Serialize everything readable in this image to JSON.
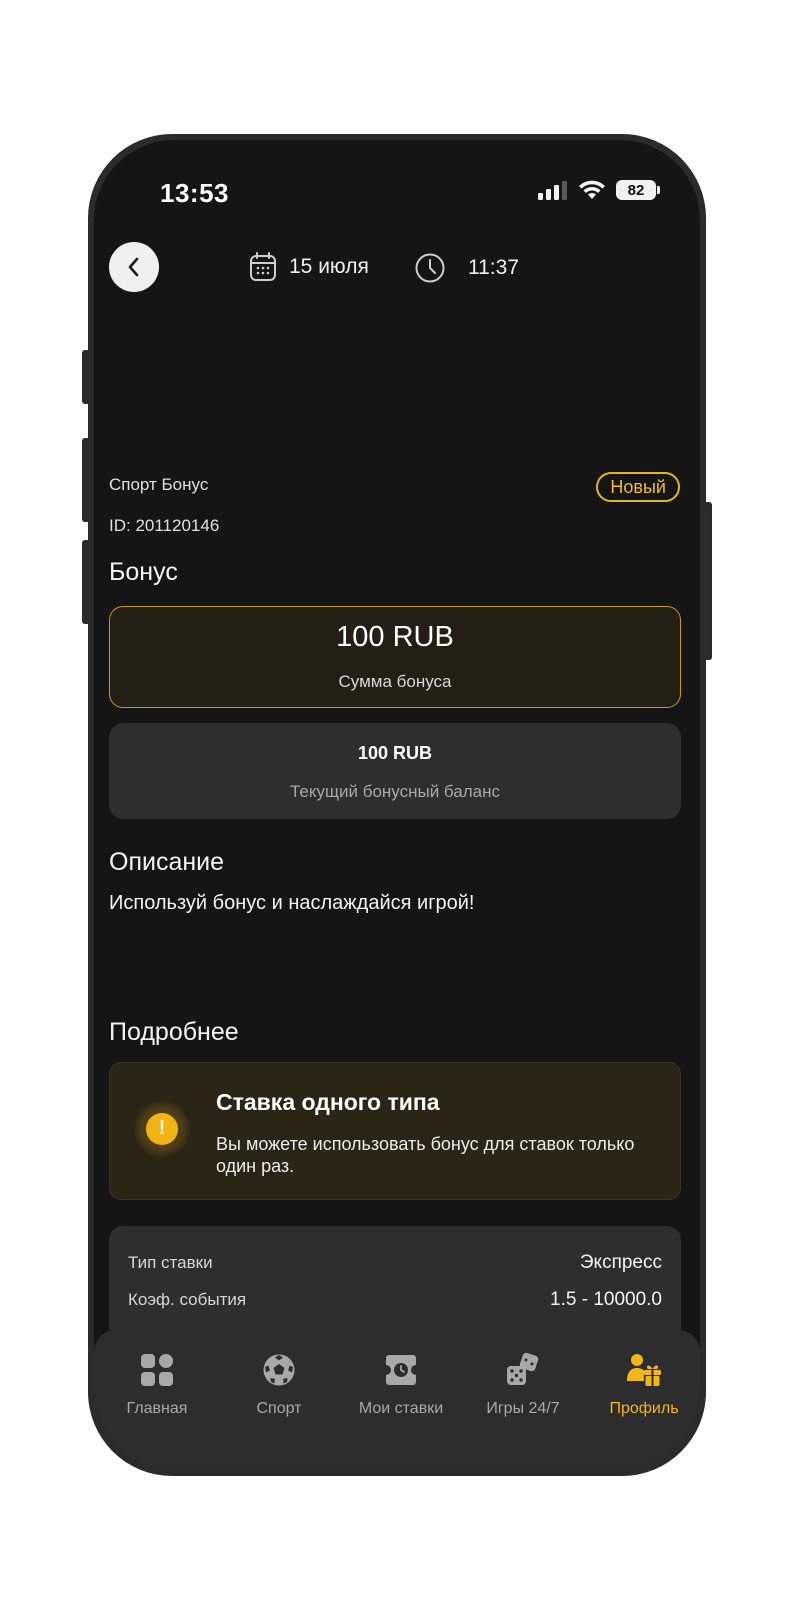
{
  "status_bar": {
    "time": "13:53",
    "battery": "82"
  },
  "header": {
    "date": "15 июля",
    "time": "11:37"
  },
  "bonus": {
    "type_label": "Спорт Бонус",
    "id_label": "ID: 201120146",
    "status_badge": "Новый",
    "section_title": "Бонус",
    "amount_value": "100 RUB",
    "amount_label": "Сумма бонуса",
    "balance_value": "100 RUB",
    "balance_label": "Текущий бонусный баланс"
  },
  "description": {
    "title": "Описание",
    "text": "Используй бонус и наслаждайся игрой!"
  },
  "details": {
    "title": "Подробнее",
    "info_icon": "exclamation-icon",
    "info_title": "Ставка одного типа",
    "info_text": "Вы можете использовать бонус для ставок только один раз.",
    "rows": [
      {
        "key": "Тип ставки",
        "value": "Экспресс"
      },
      {
        "key": "Коэф. события",
        "value": "1.5 - 10000.0"
      }
    ]
  },
  "tabbar": {
    "accent_color": "#f1b618",
    "items": [
      {
        "label": "Главная",
        "icon": "home-grid-icon",
        "active": false
      },
      {
        "label": "Спорт",
        "icon": "soccer-ball-icon",
        "active": false
      },
      {
        "label": "Мои ставки",
        "icon": "bet-ticket-icon",
        "active": false
      },
      {
        "label": "Игры 24/7",
        "icon": "dice-icon",
        "active": false
      },
      {
        "label": "Профиль",
        "icon": "profile-gift-icon",
        "active": true
      }
    ]
  }
}
